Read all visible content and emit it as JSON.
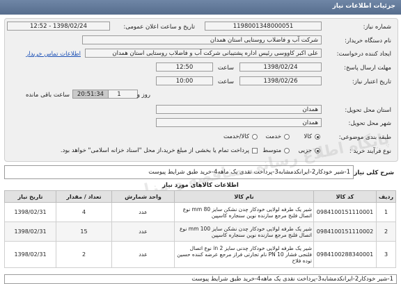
{
  "header": {
    "title": "جزئیات اطلاعات نیاز"
  },
  "form": {
    "need_number_label": "شماره نیاز:",
    "need_number": "1198001348000051",
    "announce_label": "تاریخ و ساعت اعلان عمومی:",
    "announce_value": "1398/02/24 - 12:52",
    "buyer_org_label": "نام دستگاه خریدار:",
    "buyer_org": "شرکت آب و فاضلاب روستایی استان همدان",
    "creator_label": "ایجاد کننده درخواست:",
    "creator": "علی اکبر  کاووسی رئیس اداره پشتیبانی شرکت آب و فاضلاب روستایی استان همدان",
    "contact_link": "اطلاعات تماس خریدار",
    "send_deadline_label": "مهلت ارسال پاسخ:",
    "send_date": "1398/02/24",
    "time_label": "ساعت",
    "send_time": "12:50",
    "validity_label": "تاریخ اعتبار نیاز:",
    "validity_date": "1398/02/26",
    "validity_time": "10:00",
    "days_value": "1",
    "days_label": "روز و",
    "timer_value": "20:51:34",
    "remaining_label": "ساعت باقی مانده",
    "province_label": "استان محل تحویل:",
    "province": "همدان",
    "city_label": "شهر محل تحویل:",
    "city": "همدان",
    "category_label": "طبقه بندی موضوعی:",
    "cat_goods": "کالا",
    "cat_service": "خدمت",
    "cat_goods_service": "کالا/خدمت",
    "process_label": "نوع فرآیند خرید :",
    "proc_partial": "جزیی",
    "proc_medium": "متوسط",
    "payment_note": "پرداخت تمام یا بخشی از مبلغ خرید،از محل \"اسناد خزانه اسلامی\" خواهد بود."
  },
  "summary": {
    "label": "شرح کلی نیاز:",
    "text": "1-شیر خودکار2-ایرانکدمشابه3-پرداخت نقدی یک ماهه4-خرید طبق شرایط پیوست"
  },
  "items": {
    "title": "اطلاعات کالاهای مورد نیاز",
    "columns": [
      "ردیف",
      "کد کالا",
      "نام کالا",
      "واحد شمارش",
      "تعداد / مقدار",
      "تاریخ نیاز"
    ],
    "rows": [
      {
        "idx": "1",
        "code": "0984100151110001",
        "name": "شیر یک طرفه لولایی خودکار چدن نشکن سایز 80 mm نوع اتصال فلنج مرجع سازنده نوین سنجاره کاسپین",
        "unit": "عدد",
        "qty": "4",
        "date": "1398/02/31"
      },
      {
        "idx": "2",
        "code": "0984100151110002",
        "name": "شیر یک طرفه لولایی خودکار چدن نشکن سایز 100 mm نوع اتصال فلنج مرجع سازنده نوین سنجاره کاسپین",
        "unit": "عدد",
        "qty": "15",
        "date": "1398/02/31"
      },
      {
        "idx": "3",
        "code": "0984100288340001",
        "name": "شیر یک طرفه لولایی خودکار چدنی سایز 2 in نوع اتصال فلنجی فشار PN 10 نام تجارتی فراز مرجع عرضه کننده حسین توده فلاح",
        "unit": "عدد",
        "qty": "2",
        "date": "1398/02/31"
      }
    ]
  },
  "watermark": "پایگاه اطلاع رسانی مناقصه و مزایده",
  "bottom_text": "1-شیر خودکار2-ایرانکدمشابه3-پرداخت نقدی یک ماهه4-خرید طبق شرایط پیوست"
}
